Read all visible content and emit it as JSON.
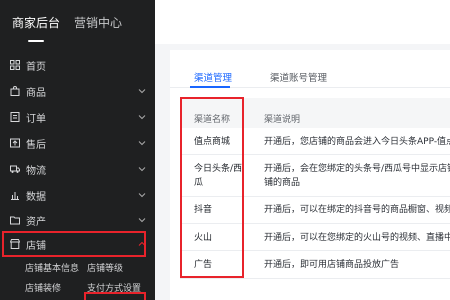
{
  "sidebar": {
    "top_tabs": [
      {
        "label": "商家后台",
        "active": true
      },
      {
        "label": "营销中心",
        "active": false
      }
    ],
    "menu": [
      {
        "label": "首页",
        "icon": "grid-icon",
        "has_chevron": false
      },
      {
        "label": "商品",
        "icon": "bag-icon",
        "has_chevron": true
      },
      {
        "label": "订单",
        "icon": "order-icon",
        "has_chevron": true
      },
      {
        "label": "售后",
        "icon": "after-sales-icon",
        "has_chevron": true
      },
      {
        "label": "物流",
        "icon": "truck-icon",
        "has_chevron": true
      },
      {
        "label": "数据",
        "icon": "chart-icon",
        "has_chevron": true
      },
      {
        "label": "资产",
        "icon": "folder-icon",
        "has_chevron": true
      },
      {
        "label": "店铺",
        "icon": "store-icon",
        "has_chevron": true,
        "expanded": true
      }
    ],
    "store_submenu": [
      {
        "label": "店铺基本信息"
      },
      {
        "label": "店铺等级"
      },
      {
        "label": "店铺装修"
      },
      {
        "label": "支付方式设置"
      }
    ]
  },
  "main": {
    "tabs": [
      {
        "label": "渠道管理",
        "active": true
      },
      {
        "label": "渠道账号管理",
        "active": false
      }
    ],
    "table": {
      "headers": [
        "渠道名称",
        "渠道说明"
      ],
      "rows": [
        {
          "name": "值点商城",
          "desc": "开通后，您店铺的商品会进入今日头条APP-值点频道"
        },
        {
          "name_line1": "今日头条/西",
          "name_line2": "瓜",
          "desc_line1": "开通后，会在您绑定的头条号/西瓜号中显示店铺入口",
          "desc_line2": "铺的商品"
        },
        {
          "name": "抖音",
          "desc": "开通后，可以在绑定的抖音号的商品橱窗、视频中"
        },
        {
          "name": "火山",
          "desc": "开通后，可以在您绑定的火山号的视频、直播中插入"
        },
        {
          "name": "广告",
          "desc": "开通后，即可用店铺商品投放广告"
        }
      ]
    }
  },
  "colors": {
    "sidebar_bg": "#1f2021",
    "accent": "#1966ff",
    "highlight": "#e8232b"
  }
}
